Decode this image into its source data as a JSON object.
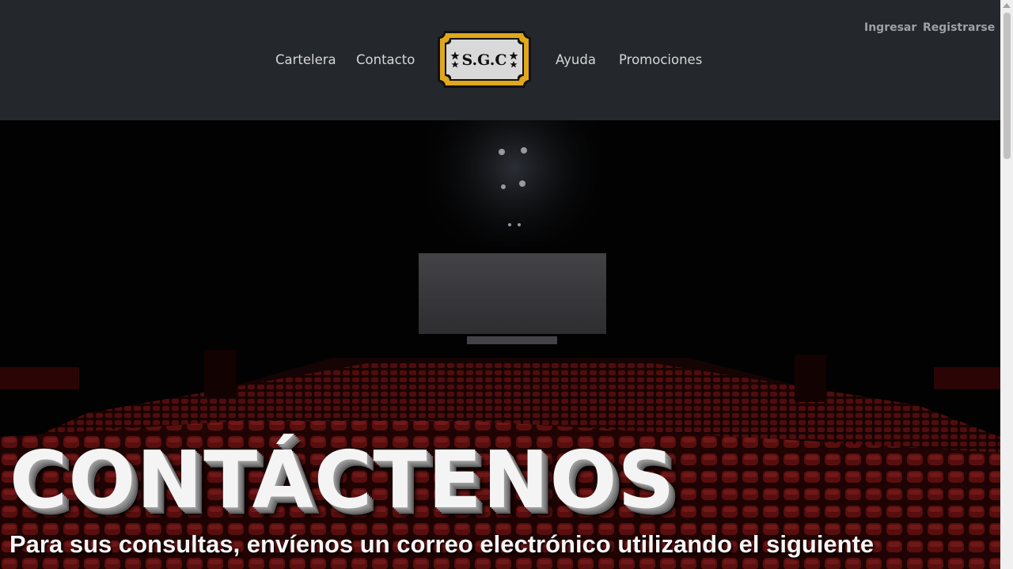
{
  "nav": {
    "items": [
      "Cartelera",
      "Contacto",
      "Ayuda",
      "Promociones"
    ],
    "login_label": "Ingresar",
    "register_label": "Registrarse",
    "logo_text": "S.G.C"
  },
  "hero": {
    "title": "CONTÁCTENOS",
    "subtitle": "Para sus consultas, envíenos un correo electrónico utilizando el siguiente"
  },
  "colors": {
    "navbar_bg": "#24272c",
    "logo_gold": "#e0a81a",
    "seat_red": "#6b1010"
  }
}
